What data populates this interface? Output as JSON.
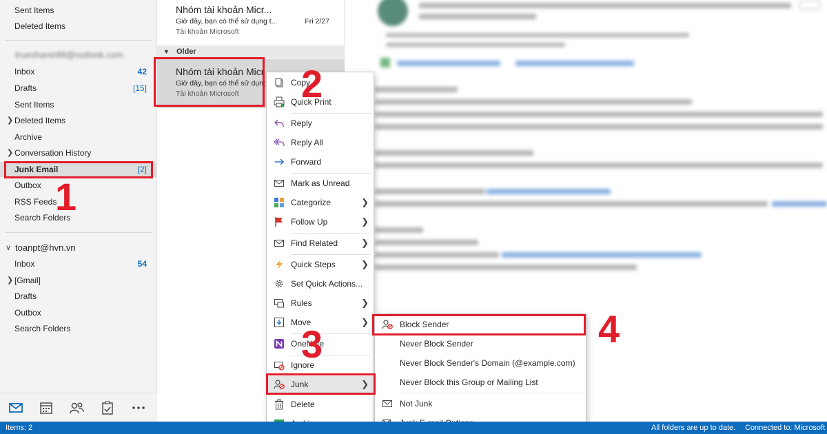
{
  "folders_top": [
    {
      "label": "Sent Items"
    },
    {
      "label": "Deleted Items"
    }
  ],
  "account1": {
    "name": "truesharer88@outlook.com",
    "folders": [
      {
        "label": "Inbox",
        "count": "42"
      },
      {
        "label": "Drafts",
        "count": "[15]"
      },
      {
        "label": "Sent Items",
        "count": ""
      },
      {
        "label": "Deleted Items",
        "count": ""
      },
      {
        "label": "Archive",
        "count": ""
      },
      {
        "label": "Conversation History",
        "count": ""
      },
      {
        "label": "Junk Email",
        "count": "[2]"
      },
      {
        "label": "Outbox",
        "count": ""
      },
      {
        "label": "RSS Feeds",
        "count": ""
      },
      {
        "label": "Search Folders",
        "count": ""
      }
    ]
  },
  "account2": {
    "name": "toanpt@hvn.vn",
    "folders": [
      {
        "label": "Inbox",
        "count": "54"
      },
      {
        "label": "[Gmail]",
        "count": ""
      },
      {
        "label": "Drafts",
        "count": ""
      },
      {
        "label": "Outbox",
        "count": ""
      },
      {
        "label": "Search Folders",
        "count": ""
      }
    ]
  },
  "messages": [
    {
      "sender": "Nhóm tài khoản Micr...",
      "subject": "Giờ đây, bạn có thể sử dụng t...",
      "preview": "Tài khoản Microsoft",
      "date": "Fri 2/27"
    },
    {
      "sender": "Nhóm tài khoản Micr",
      "subject": "Giờ đây, bạn có thể sử dụng",
      "preview": "Tài khoản Microsoft",
      "date": ""
    }
  ],
  "group_header": "Older",
  "context_menu": {
    "copy": "Copy",
    "quick_print": "Quick Print",
    "reply": "Reply",
    "reply_all": "Reply All",
    "forward": "Forward",
    "mark_unread": "Mark as Unread",
    "categorize": "Categorize",
    "follow_up": "Follow Up",
    "find_related": "Find Related",
    "quick_steps": "Quick Steps",
    "set_quick_actions": "Set Quick Actions...",
    "rules": "Rules",
    "move": "Move",
    "onenote": "OneNote",
    "ignore": "Ignore",
    "junk": "Junk",
    "delete": "Delete",
    "archive": "Archive..."
  },
  "junk_submenu": {
    "block_sender": "Block Sender",
    "never_block_sender": "Never Block Sender",
    "never_block_domain": "Never Block Sender's Domain (@example.com)",
    "never_block_group": "Never Block this Group or Mailing List",
    "not_junk": "Not Junk",
    "junk_options": "Junk E-mail Options..."
  },
  "status_bar": {
    "items": "Items: 2",
    "sync": "All folders are up to date.",
    "connection": "Connected to: Microsoft E"
  },
  "annotations": {
    "step1": "1",
    "step2": "2",
    "step3": "3",
    "step4": "4"
  },
  "colors": {
    "accent": "#0f6cbd",
    "annotation": "#e21d2b"
  }
}
